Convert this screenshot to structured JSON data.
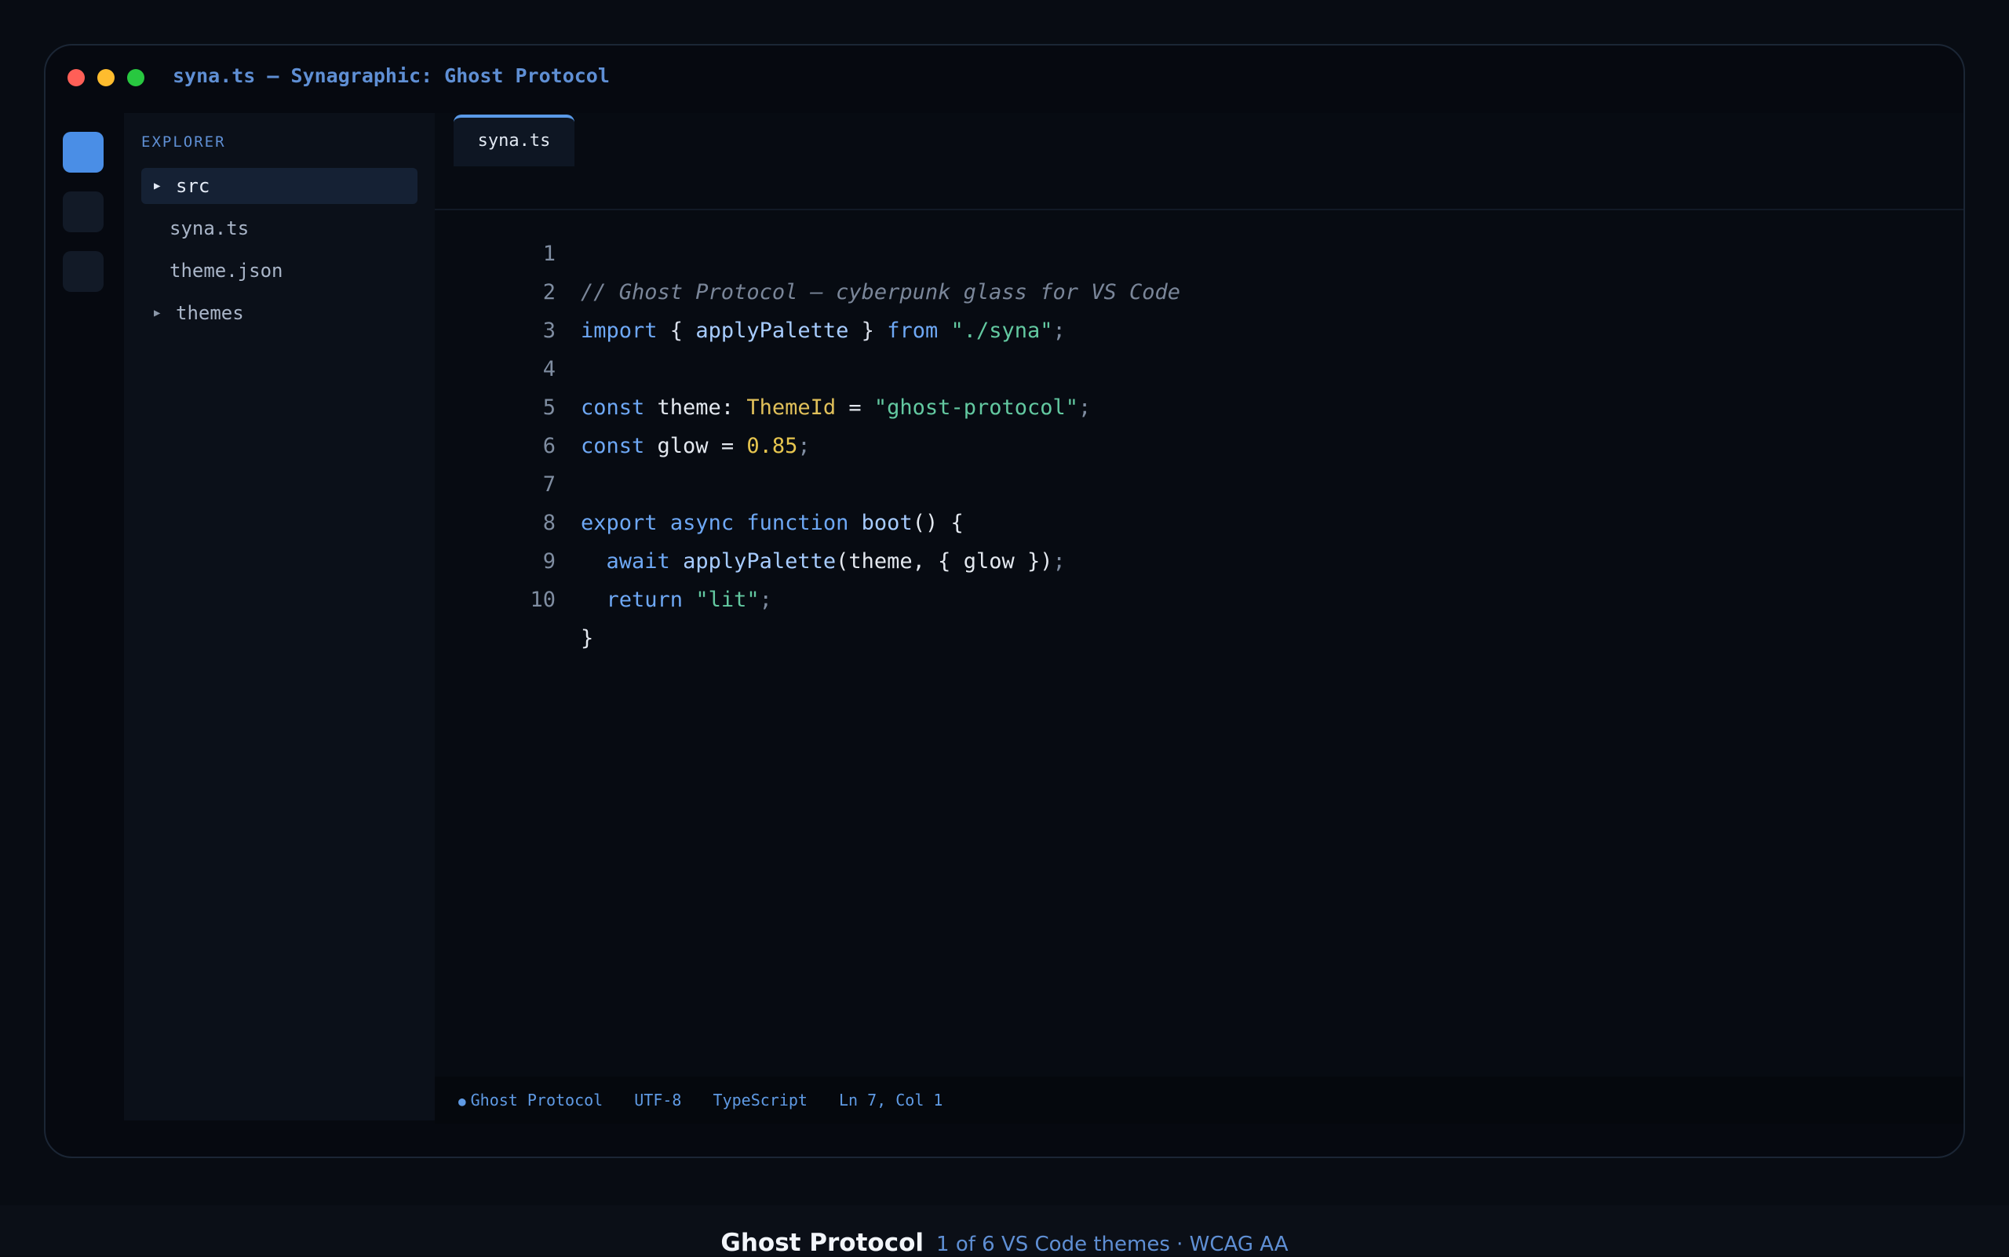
{
  "window": {
    "title": "syna.ts — Synagraphic: Ghost Protocol"
  },
  "sidebar": {
    "heading": "EXPLORER",
    "items": [
      {
        "label": "src",
        "type": "folder",
        "selected": true
      },
      {
        "label": "syna.ts",
        "type": "file"
      },
      {
        "label": "theme.json",
        "type": "file"
      },
      {
        "label": "themes",
        "type": "folder"
      }
    ]
  },
  "editor": {
    "tab_label": "syna.ts",
    "lines": [
      {
        "n": "1"
      },
      {
        "n": "2"
      },
      {
        "n": "3"
      },
      {
        "n": "4"
      },
      {
        "n": "5"
      },
      {
        "n": "6"
      },
      {
        "n": "7"
      },
      {
        "n": "8"
      },
      {
        "n": "9"
      },
      {
        "n": "10"
      }
    ],
    "code": {
      "l1": {
        "comment": "// Ghost Protocol — cyberpunk glass for VS Code"
      },
      "l2": {
        "kw1": "import",
        "p1": " { ",
        "fn": "applyPalette",
        "p2": " } ",
        "kw2": "from",
        "sp": " ",
        "str": "\"./syna\"",
        "semi": ";"
      },
      "l4": {
        "kw": "const",
        "name": " theme: ",
        "type": "ThemeId",
        "eq": " = ",
        "str": "\"ghost-protocol\"",
        "semi": ";"
      },
      "l5": {
        "kw": "const",
        "name": " glow = ",
        "num": "0.85",
        "semi": ";"
      },
      "l7": {
        "kw1": "export",
        "sp1": " ",
        "kw2": "async",
        "sp2": " ",
        "kw3": "function",
        "sp3": " ",
        "fn": "boot",
        "rest": "() {"
      },
      "l8": {
        "indent": "  ",
        "kw": "await",
        "sp": " ",
        "fn": "applyPalette",
        "rest": "(theme, { glow })",
        "semi": ";"
      },
      "l9": {
        "indent": "  ",
        "kw": "return",
        "sp": " ",
        "str": "\"lit\"",
        "semi": ";"
      },
      "l10": {
        "brace": "}"
      }
    }
  },
  "statusbar": {
    "theme_dot": "●",
    "theme": "Ghost Protocol",
    "encoding": "UTF-8",
    "language": "TypeScript",
    "position": "Ln 7, Col 1"
  },
  "footer": {
    "title": "Ghost Protocol",
    "subtitle": "1 of 6 VS Code themes · WCAG AA"
  },
  "colors": {
    "accent": "#5a9ae8",
    "keyword": "#6ea8f5",
    "string": "#63c9a1",
    "number": "#e7c64f",
    "comment": "#7a8699"
  }
}
